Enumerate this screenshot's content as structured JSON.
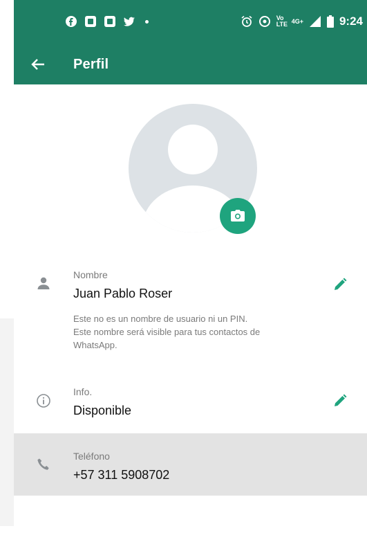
{
  "colors": {
    "accent": "#1e7f64",
    "fab": "#1fa47e",
    "row_highlight": "#e3e3e3"
  },
  "status_bar": {
    "left_icons": [
      "facebook-icon",
      "app-icon",
      "app-icon",
      "twitter-icon",
      "dot-icon"
    ],
    "right_icons": [
      "alarm-icon",
      "hotspot-icon",
      "volte-icon",
      "4g-signal-icon",
      "battery-icon"
    ],
    "volte_text": "Vo LTE",
    "network_text": "4G+",
    "time": "9:24"
  },
  "toolbar": {
    "title": "Perfil",
    "back_icon": "arrow-left-icon"
  },
  "avatar": {
    "edit_icon": "camera-icon"
  },
  "name_section": {
    "label": "Nombre",
    "value": "Juan Pablo Roser",
    "note_line1": "Este no es un nombre de usuario ni un PIN.",
    "note_line2": "Este nombre será visible para tus contactos de",
    "note_line3": "WhatsApp.",
    "icon": "person-icon",
    "edit_icon": "pencil-icon"
  },
  "info_section": {
    "label": "Info.",
    "value": "Disponible",
    "icon": "info-icon",
    "edit_icon": "pencil-icon"
  },
  "phone_section": {
    "label": "Teléfono",
    "value": "+57 311 5908702",
    "icon": "phone-icon"
  }
}
